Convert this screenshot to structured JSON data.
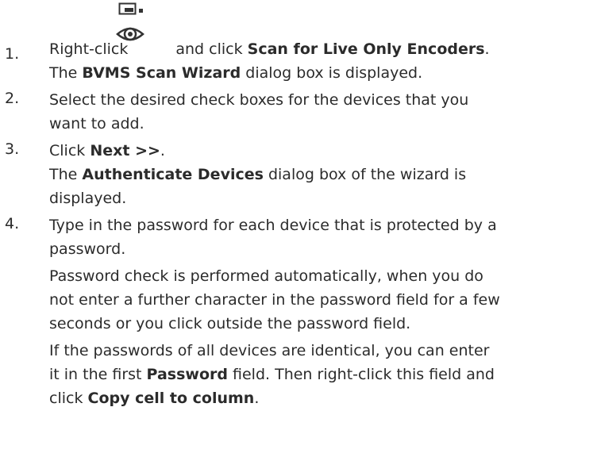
{
  "steps": [
    {
      "number": "1.",
      "line1_pre": "Right-click",
      "icon": "live-only-encoder-icon",
      "line1_mid": "and click",
      "line1_bold": "Scan for Live Only Encoders",
      "line1_post": ".",
      "line2_pre": "The",
      "line2_bold": "BVMS Scan Wizard",
      "line2_post": "dialog box is displayed."
    },
    {
      "number": "2.",
      "line1": "Select the desired check boxes for the devices that you",
      "line2": "want to add."
    },
    {
      "number": "3.",
      "line1_pre": "Click",
      "line1_bold": "Next >>",
      "line1_post": ".",
      "line2_pre": "The",
      "line2_bold": "Authenticate Devices",
      "line2_post": "dialog box of the wizard is",
      "line3": "displayed."
    },
    {
      "number": "4.",
      "line1": "Type in the password for each device that is protected by a",
      "line2": "password.",
      "para2_line1": "Password check is performed automatically, when you do",
      "para2_line2": "not enter a further character in the password field for a few",
      "para2_line3": "seconds or you click outside the password field.",
      "para3_line1": "If the passwords of all devices are identical, you can enter",
      "para3_line2_pre": "it in the first",
      "para3_line2_bold": "Password",
      "para3_line2_post": "field. Then right-click this field and",
      "para3_line3_pre": "click",
      "para3_line3_bold": "Copy cell to column",
      "para3_line3_post": "."
    }
  ]
}
